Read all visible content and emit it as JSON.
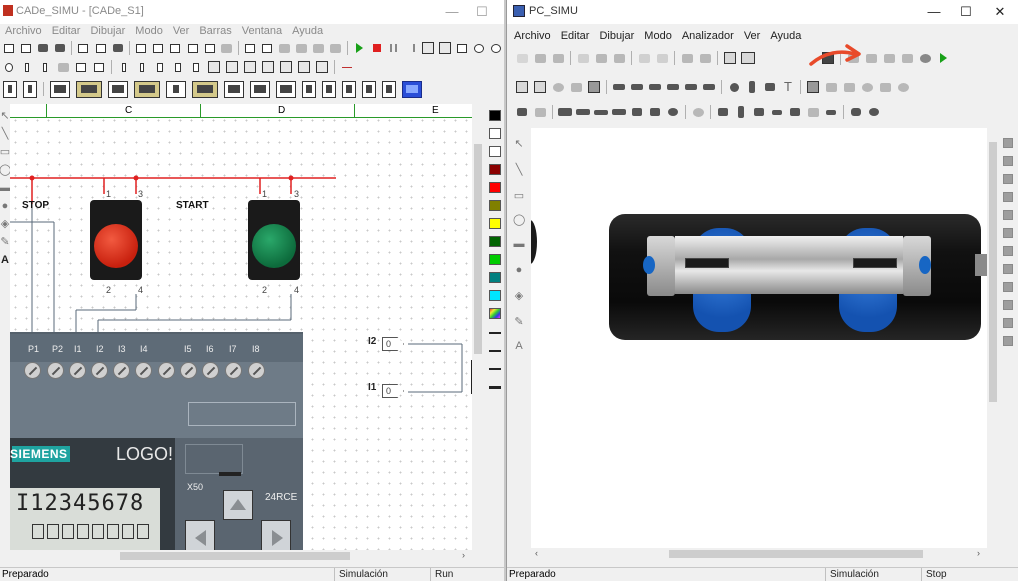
{
  "left_window": {
    "title": "CADe_SIMU - [CADe_S1]",
    "menu": [
      "Archivo",
      "Editar",
      "Dibujar",
      "Modo",
      "Ver",
      "Barras",
      "Ventana",
      "Ayuda"
    ],
    "columns": [
      "C",
      "D",
      "E"
    ],
    "labels": {
      "stop": "STOP",
      "start": "START"
    },
    "stop_pins": [
      "1",
      "3",
      "2",
      "4"
    ],
    "start_pins": [
      "1",
      "3",
      "2",
      "4"
    ],
    "plc": {
      "io_labels": [
        "P1",
        "P2",
        "I1",
        "I2",
        "I3",
        "I4",
        "I5",
        "I6",
        "I7",
        "I8"
      ],
      "brand": "SIEMENS",
      "model": "LOGO!",
      "display_text": "I12345678",
      "model_code_top": "X50",
      "model_code": "24RCE"
    },
    "inputs": [
      {
        "tag": "I2",
        "value": "0"
      },
      {
        "tag": "I1",
        "value": "0"
      }
    ],
    "palette_colors": [
      "#000000",
      "#ffffff",
      "#ffffff",
      "#8b0000",
      "#ff0000",
      "#808000",
      "#ffff00",
      "#006400",
      "#00cc00",
      "#008080",
      "#00e5ff"
    ],
    "status": {
      "ready": "Preparado",
      "mode": "Simulación",
      "state": "Run"
    }
  },
  "right_window": {
    "title": "PC_SIMU",
    "menu": [
      "Archivo",
      "Editar",
      "Dibujar",
      "Modo",
      "Analizador",
      "Ver",
      "Ayuda"
    ],
    "status": {
      "ready": "Preparado",
      "mode": "Simulación",
      "state": "Stop"
    }
  }
}
